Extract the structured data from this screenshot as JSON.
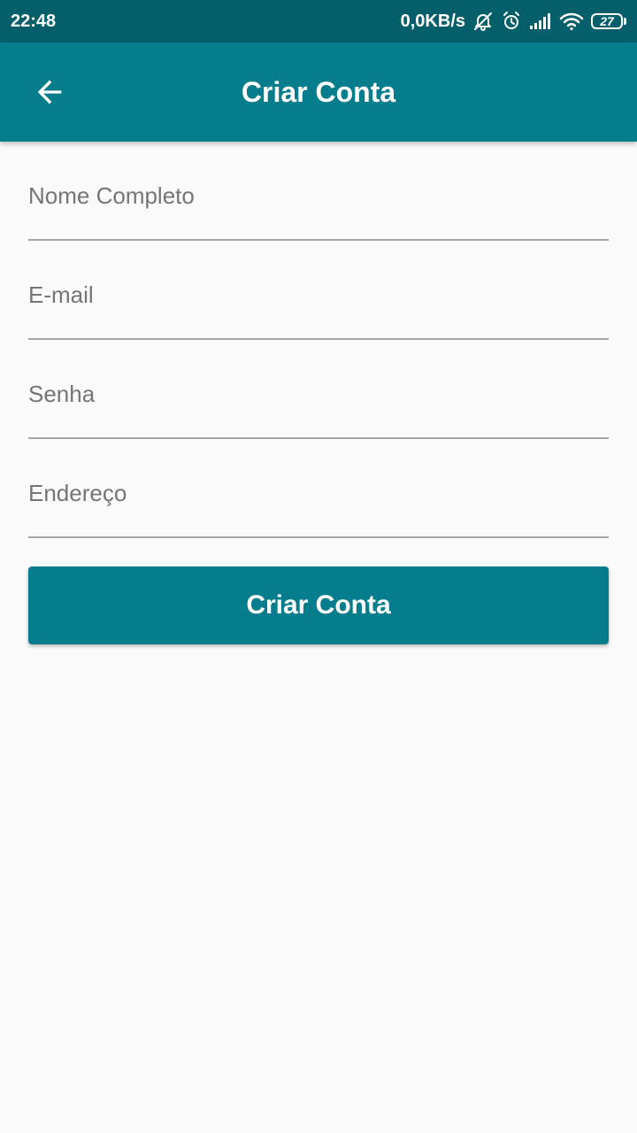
{
  "status_bar": {
    "time": "22:48",
    "network_speed": "0,0KB/s",
    "battery_level": "27",
    "icons": [
      "muted-bell-icon",
      "alarm-clock-icon",
      "cell-signal-icon",
      "wifi-icon",
      "battery-icon"
    ],
    "background_color": "#055f6b"
  },
  "app_bar": {
    "title": "Criar Conta",
    "back_icon": "arrow-left-icon",
    "background_color": "#067d8c"
  },
  "form": {
    "fields": [
      {
        "placeholder": "Nome Completo",
        "value": ""
      },
      {
        "placeholder": "E-mail",
        "value": ""
      },
      {
        "placeholder": "Senha",
        "value": ""
      },
      {
        "placeholder": "Endereço",
        "value": ""
      }
    ],
    "submit_label": "Criar Conta",
    "accent_color": "#067d8c"
  }
}
